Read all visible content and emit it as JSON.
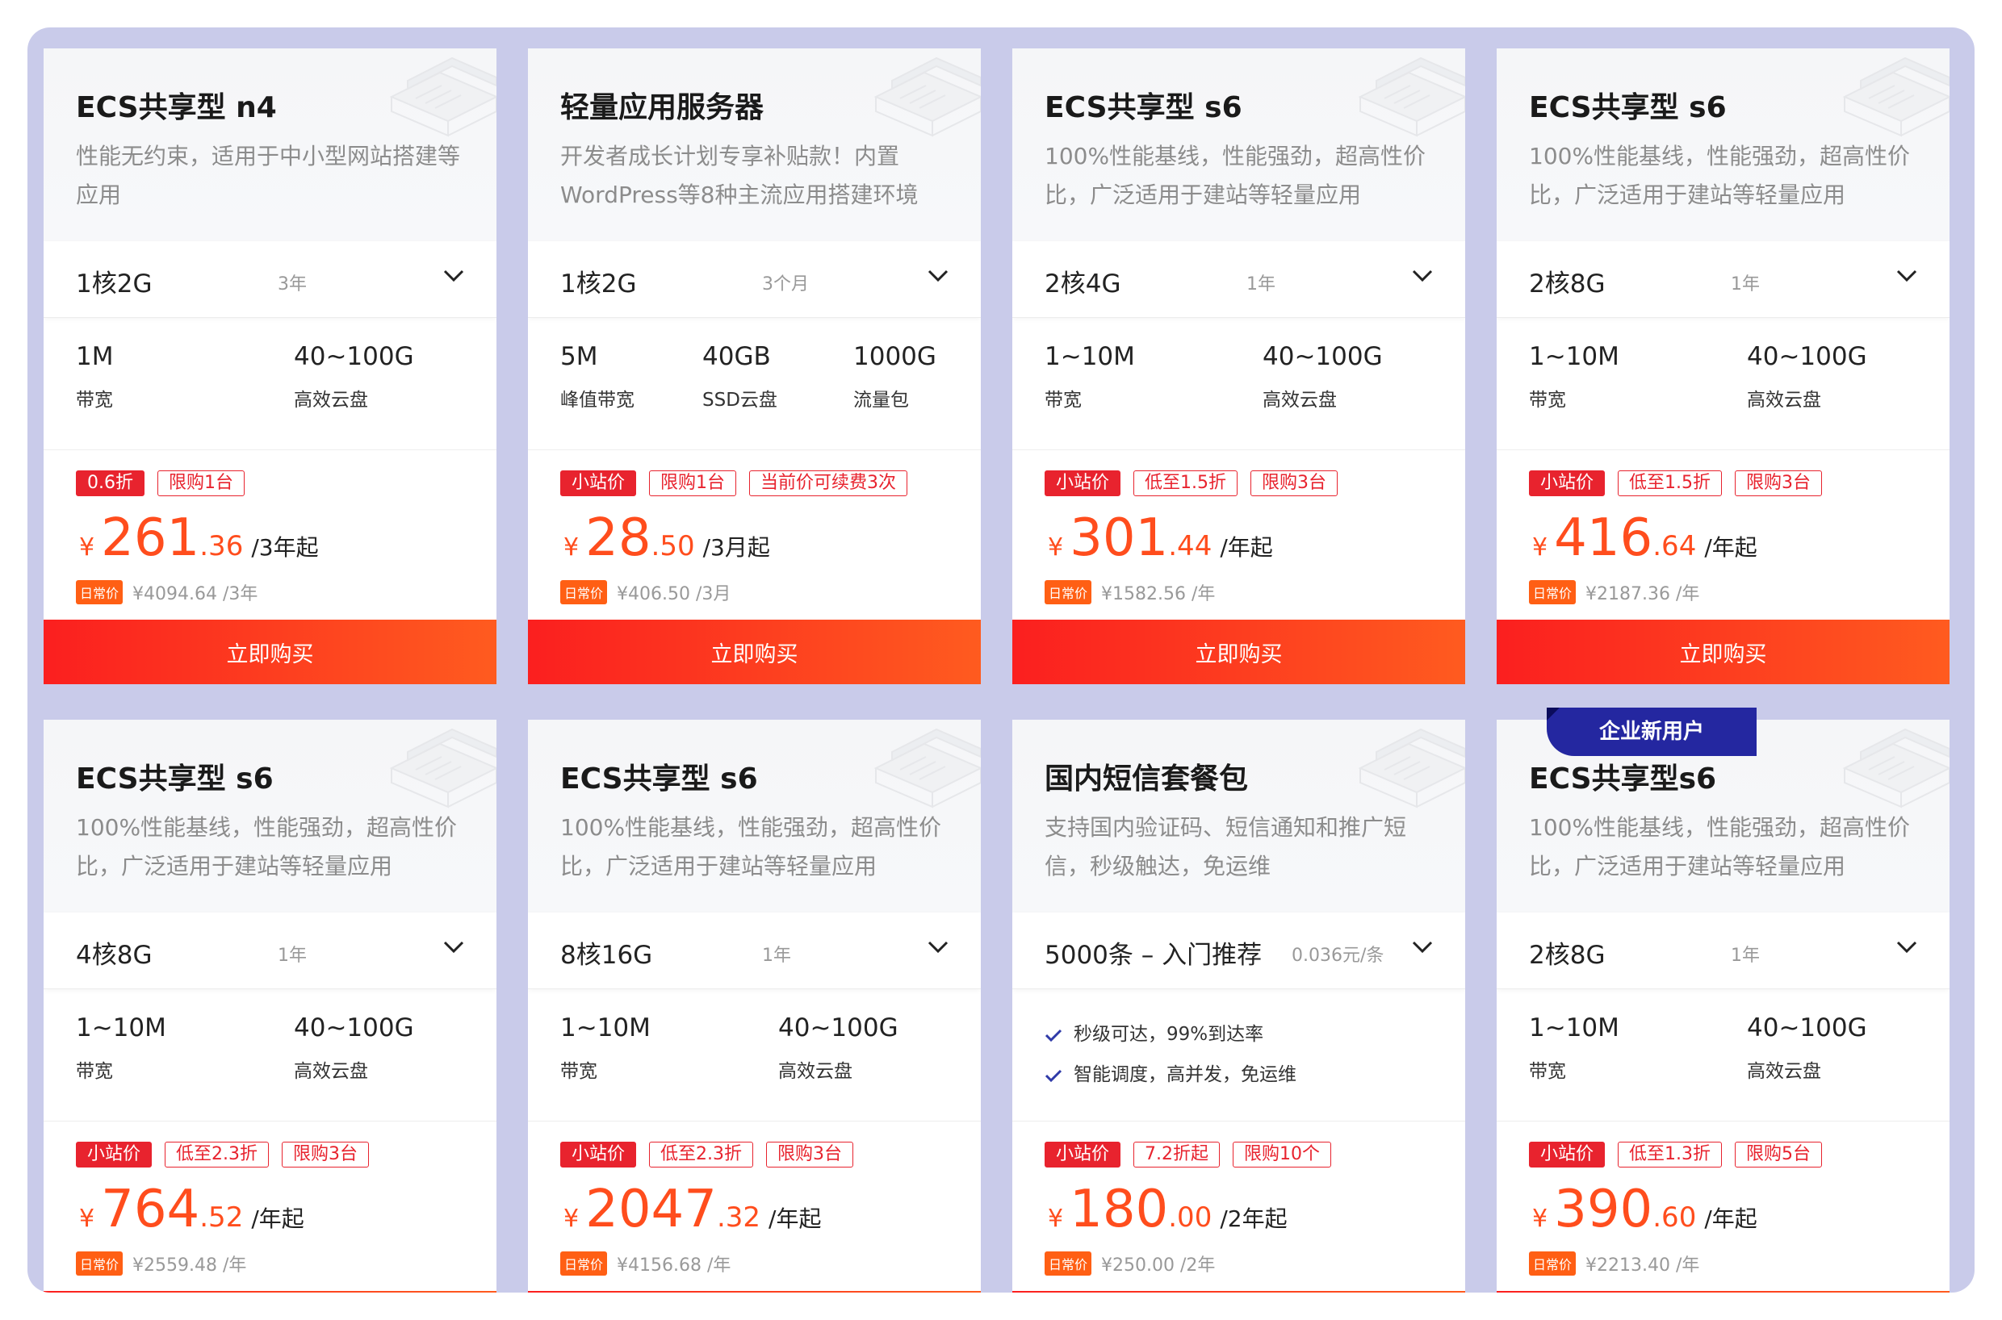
{
  "colors": {
    "accent_red": "#e8232e",
    "price_orange": "#ff4d1d",
    "badge_blue": "#2427a0",
    "daily_badge": "#ff5f14"
  },
  "buy_label": "立即购买",
  "enterprise_badge": "企业新用户",
  "cards": [
    {
      "title": "ECS共享型 n4",
      "desc": "性能无约束，适用于中小型网站搭建等应用",
      "config": "1核2G",
      "period": "3年",
      "specs": [
        {
          "value": "1M",
          "label": "带宽"
        },
        {
          "value": "40~100G",
          "label": "高效云盘"
        }
      ],
      "tags": [
        {
          "text": "0.6折",
          "solid": true
        },
        {
          "text": "限购1台",
          "solid": false
        }
      ],
      "price": {
        "yen": "¥",
        "int": "261",
        "dec": ".36",
        "unit": "/3年起"
      },
      "orig_badge": "日常价",
      "orig": "¥4094.64 /3年"
    },
    {
      "title": "轻量应用服务器",
      "desc": "开发者成长计划专享补贴款！内置WordPress等8种主流应用搭建环境",
      "config": "1核2G",
      "period": "3个月",
      "specs": [
        {
          "value": "5M",
          "label": "峰值带宽"
        },
        {
          "value": "40GB",
          "label": "SSD云盘"
        },
        {
          "value": "1000G",
          "label": "流量包"
        }
      ],
      "tags": [
        {
          "text": "小站价",
          "solid": true
        },
        {
          "text": "限购1台",
          "solid": false
        },
        {
          "text": "当前价可续费3次",
          "solid": false
        }
      ],
      "price": {
        "yen": "¥",
        "int": "28",
        "dec": ".50",
        "unit": "/3月起"
      },
      "orig_badge": "日常价",
      "orig": "¥406.50 /3月"
    },
    {
      "title": "ECS共享型 s6",
      "desc": "100%性能基线，性能强劲，超高性价比，广泛适用于建站等轻量应用",
      "config": "2核4G",
      "period": "1年",
      "specs": [
        {
          "value": "1~10M",
          "label": "带宽"
        },
        {
          "value": "40~100G",
          "label": "高效云盘"
        }
      ],
      "tags": [
        {
          "text": "小站价",
          "solid": true
        },
        {
          "text": "低至1.5折",
          "solid": false
        },
        {
          "text": "限购3台",
          "solid": false
        }
      ],
      "price": {
        "yen": "¥",
        "int": "301",
        "dec": ".44",
        "unit": "/年起"
      },
      "orig_badge": "日常价",
      "orig": "¥1582.56 /年"
    },
    {
      "title": "ECS共享型 s6",
      "desc": "100%性能基线，性能强劲，超高性价比，广泛适用于建站等轻量应用",
      "config": "2核8G",
      "period": "1年",
      "specs": [
        {
          "value": "1~10M",
          "label": "带宽"
        },
        {
          "value": "40~100G",
          "label": "高效云盘"
        }
      ],
      "tags": [
        {
          "text": "小站价",
          "solid": true
        },
        {
          "text": "低至1.5折",
          "solid": false
        },
        {
          "text": "限购3台",
          "solid": false
        }
      ],
      "price": {
        "yen": "¥",
        "int": "416",
        "dec": ".64",
        "unit": "/年起"
      },
      "orig_badge": "日常价",
      "orig": "¥2187.36 /年"
    },
    {
      "title": "ECS共享型 s6",
      "desc": "100%性能基线，性能强劲，超高性价比，广泛适用于建站等轻量应用",
      "config": "4核8G",
      "period": "1年",
      "specs": [
        {
          "value": "1~10M",
          "label": "带宽"
        },
        {
          "value": "40~100G",
          "label": "高效云盘"
        }
      ],
      "tags": [
        {
          "text": "小站价",
          "solid": true
        },
        {
          "text": "低至2.3折",
          "solid": false
        },
        {
          "text": "限购3台",
          "solid": false
        }
      ],
      "price": {
        "yen": "¥",
        "int": "764",
        "dec": ".52",
        "unit": "/年起"
      },
      "orig_badge": "日常价",
      "orig": "¥2559.48 /年"
    },
    {
      "title": "ECS共享型 s6",
      "desc": "100%性能基线，性能强劲，超高性价比，广泛适用于建站等轻量应用",
      "config": "8核16G",
      "period": "1年",
      "specs": [
        {
          "value": "1~10M",
          "label": "带宽"
        },
        {
          "value": "40~100G",
          "label": "高效云盘"
        }
      ],
      "tags": [
        {
          "text": "小站价",
          "solid": true
        },
        {
          "text": "低至2.3折",
          "solid": false
        },
        {
          "text": "限购3台",
          "solid": false
        }
      ],
      "price": {
        "yen": "¥",
        "int": "2047",
        "dec": ".32",
        "unit": "/年起"
      },
      "orig_badge": "日常价",
      "orig": "¥4156.68 /年"
    },
    {
      "title": "国内短信套餐包",
      "desc": "支持国内验证码、短信通知和推广短信，秒级触达，免运维",
      "config": "5000条 – 入门推荐",
      "period": "0.036元/条",
      "features": [
        "秒级可达，99%到达率",
        "智能调度，高并发，免运维"
      ],
      "tags": [
        {
          "text": "小站价",
          "solid": true
        },
        {
          "text": "7.2折起",
          "solid": false
        },
        {
          "text": "限购10个",
          "solid": false
        }
      ],
      "price": {
        "yen": "¥",
        "int": "180",
        "dec": ".00",
        "unit": "/2年起"
      },
      "orig_badge": "日常价",
      "orig": "¥250.00 /2年"
    },
    {
      "title": "ECS共享型s6",
      "desc": "100%性能基线，性能强劲，超高性价比，广泛适用于建站等轻量应用",
      "config": "2核8G",
      "period": "1年",
      "specs": [
        {
          "value": "1~10M",
          "label": "带宽"
        },
        {
          "value": "40~100G",
          "label": "高效云盘"
        }
      ],
      "tags": [
        {
          "text": "小站价",
          "solid": true
        },
        {
          "text": "低至1.3折",
          "solid": false
        },
        {
          "text": "限购5台",
          "solid": false
        }
      ],
      "price": {
        "yen": "¥",
        "int": "390",
        "dec": ".60",
        "unit": "/年起"
      },
      "orig_badge": "日常价",
      "orig": "¥2213.40 /年"
    }
  ]
}
